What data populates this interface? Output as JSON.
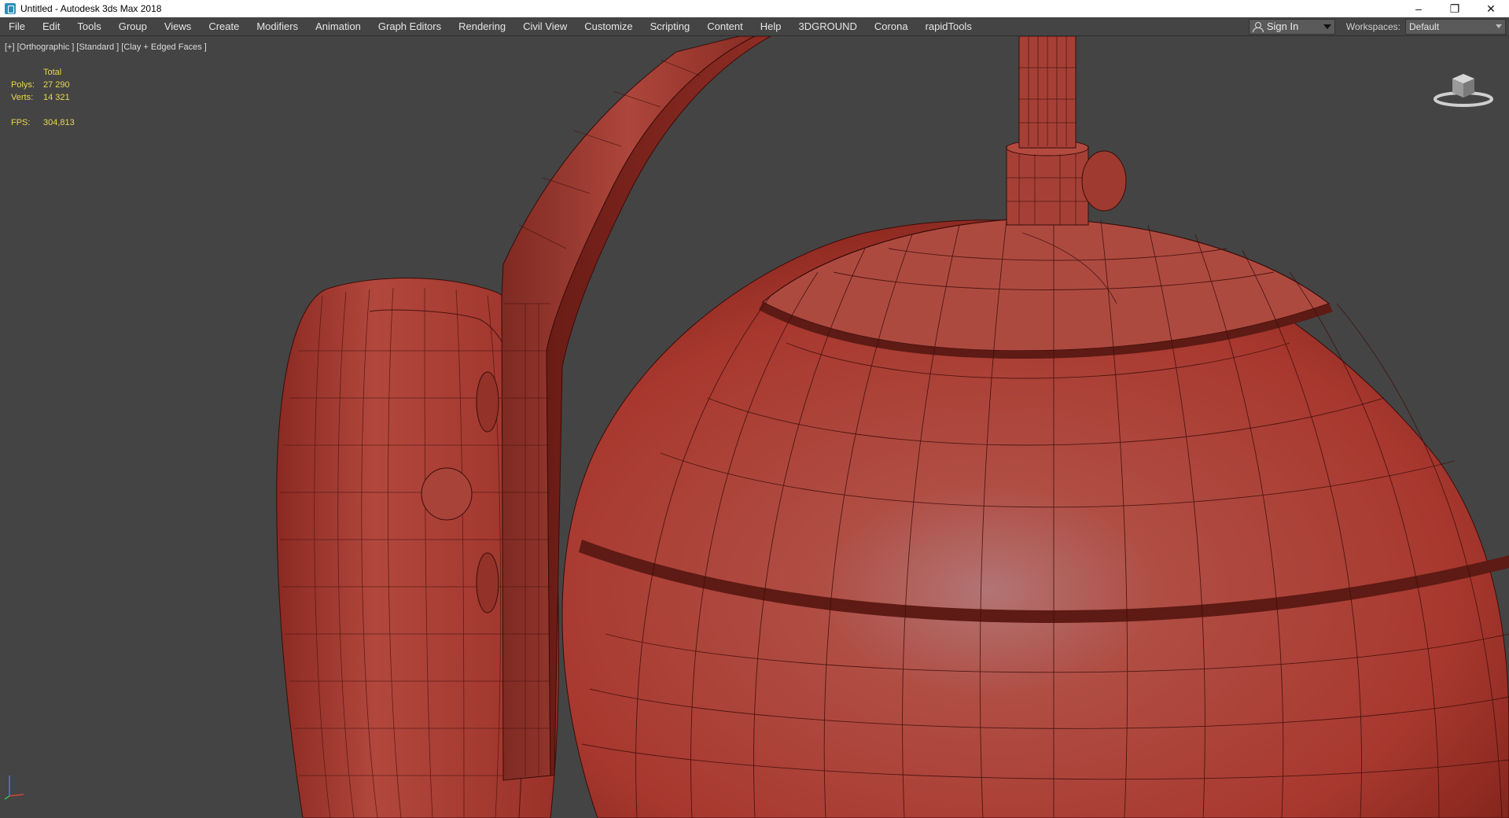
{
  "window": {
    "title": "Untitled - Autodesk 3ds Max 2018",
    "controls": [
      "minimize-icon",
      "restore-icon",
      "close-icon"
    ]
  },
  "menubar": {
    "items": [
      "File",
      "Edit",
      "Tools",
      "Group",
      "Views",
      "Create",
      "Modifiers",
      "Animation",
      "Graph Editors",
      "Rendering",
      "Civil View",
      "Customize",
      "Scripting",
      "Content",
      "Help",
      "3DGROUND",
      "Corona",
      "rapidTools"
    ],
    "sign_in": "Sign In",
    "workspaces_label": "Workspaces:",
    "workspace_value": "Default"
  },
  "viewport": {
    "label": "[+] [Orthographic ] [Standard ] [Clay + Edged Faces ]",
    "stats": {
      "header": "Total",
      "polys_label": "Polys:",
      "polys_value": "27 290",
      "verts_label": "Verts:",
      "verts_value": "14 321",
      "fps_label": "FPS:",
      "fps_value": "304,813"
    }
  },
  "colors": {
    "viewport_bg": "#444444",
    "clay_red": "#b24236",
    "stats_text": "#e8d84a"
  }
}
